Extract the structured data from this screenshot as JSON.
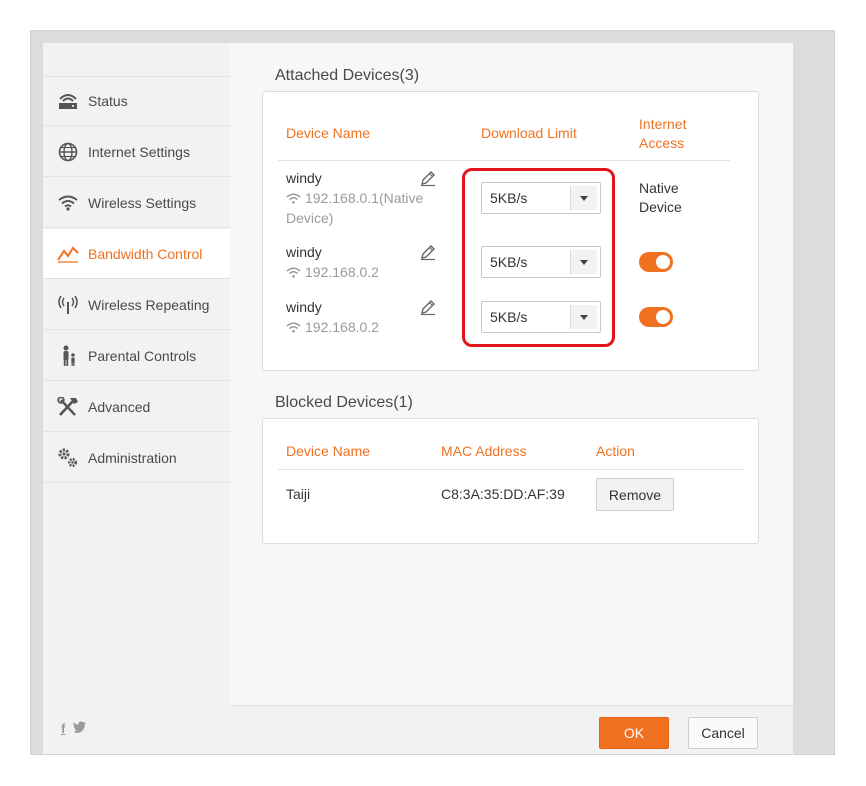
{
  "sidebar": {
    "items": [
      {
        "label": "Status",
        "icon": "router-icon",
        "active": false
      },
      {
        "label": "Internet Settings",
        "icon": "globe-icon",
        "active": false
      },
      {
        "label": "Wireless Settings",
        "icon": "wifi-icon",
        "active": false
      },
      {
        "label": "Bandwidth Control",
        "icon": "bandwidth-icon",
        "active": true
      },
      {
        "label": "Wireless Repeating",
        "icon": "antenna-icon",
        "active": false
      },
      {
        "label": "Parental Controls",
        "icon": "parent-child-icon",
        "active": false
      },
      {
        "label": "Advanced",
        "icon": "tools-icon",
        "active": false
      },
      {
        "label": "Administration",
        "icon": "gears-icon",
        "active": false
      }
    ],
    "social": {
      "facebook": "f",
      "twitter": "t"
    }
  },
  "attached": {
    "title": "Attached Devices(3)",
    "headers": {
      "name": "Device Name",
      "limit": "Download Limit",
      "access_line1": "Internet",
      "access_line2": "Access"
    },
    "devices": [
      {
        "name": "windy",
        "ip_line1": "192.168.0.1(Native",
        "ip_line2": "Device)",
        "limit": "5KB/s",
        "access_line1": "Native",
        "access_line2": "Device",
        "access_on": null
      },
      {
        "name": "windy",
        "ip_line1": "192.168.0.2",
        "ip_line2": "",
        "limit": "5KB/s",
        "access_on": true
      },
      {
        "name": "windy",
        "ip_line1": "192.168.0.2",
        "ip_line2": "",
        "limit": "5KB/s",
        "access_on": true
      }
    ]
  },
  "blocked": {
    "title": "Blocked Devices(1)",
    "headers": {
      "name": "Device Name",
      "mac": "MAC Address",
      "action": "Action"
    },
    "rows": [
      {
        "name": "Taiji",
        "mac": "C8:3A:35:DD:AF:39",
        "action_label": "Remove"
      }
    ]
  },
  "footer": {
    "ok_label": "OK",
    "cancel_label": "Cancel"
  },
  "colors": {
    "accent": "#f0711f",
    "highlight": "#e3141b"
  }
}
